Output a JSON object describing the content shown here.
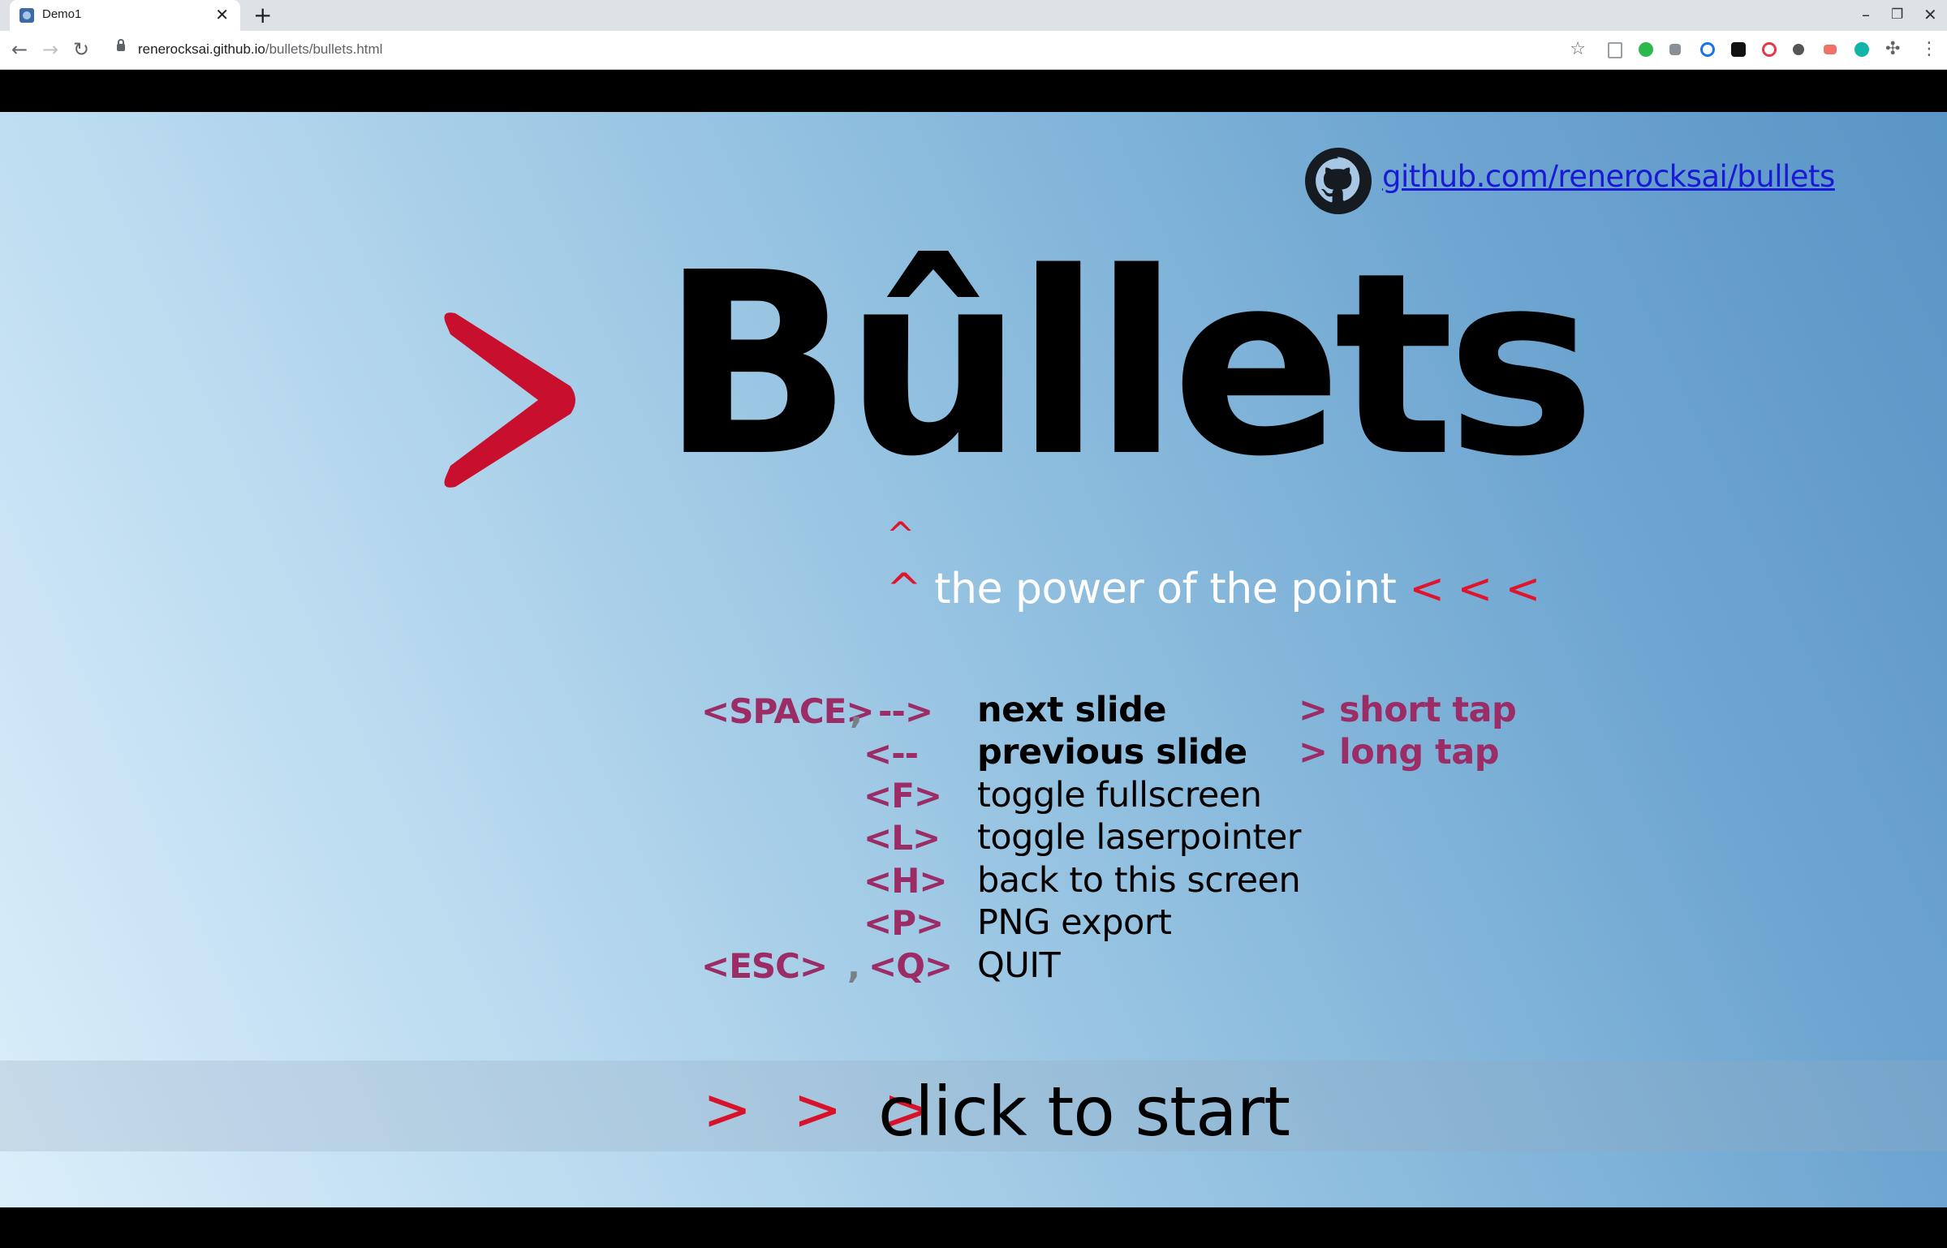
{
  "browser": {
    "tab_title": "Demo1",
    "new_tab": "+",
    "tab_close": "✕",
    "url_host": "renerocksai.github.io",
    "url_path": "/bullets/bullets.html",
    "window_min": "–",
    "window_restore": "❐",
    "window_close": "✕"
  },
  "slide": {
    "github_link": "github.com/renerocksai/bullets",
    "title": "Bûllets",
    "caret_top": "^",
    "subtitle_caret": "^",
    "subtitle": "the power of the point",
    "subtitle_arrows": "< < <",
    "shortcuts": [
      {
        "key": "<SPACE>",
        "sep": ",",
        "key2": "-->",
        "desc": "next slide",
        "bold": true
      },
      {
        "key": "<--",
        "desc": "previous slide",
        "bold": true
      },
      {
        "key": "<F>",
        "desc": "toggle fullscreen"
      },
      {
        "key": "<L>",
        "desc": "toggle laserpointer"
      },
      {
        "key": "<H>",
        "desc": "back to this screen"
      },
      {
        "key": "<P>",
        "desc": "PNG export"
      },
      {
        "key": "<ESC>",
        "sep": ",",
        "key2": "<Q>",
        "desc": "QUIT"
      }
    ],
    "taps": [
      {
        "label": ">  short tap"
      },
      {
        "label": ">  long tap"
      }
    ],
    "start_arrows": "> > >",
    "start_text": "click to start"
  },
  "colors": {
    "accent_red": "#d8122a",
    "key_purple": "#9b2c66",
    "link_blue": "#1a1ad6"
  }
}
